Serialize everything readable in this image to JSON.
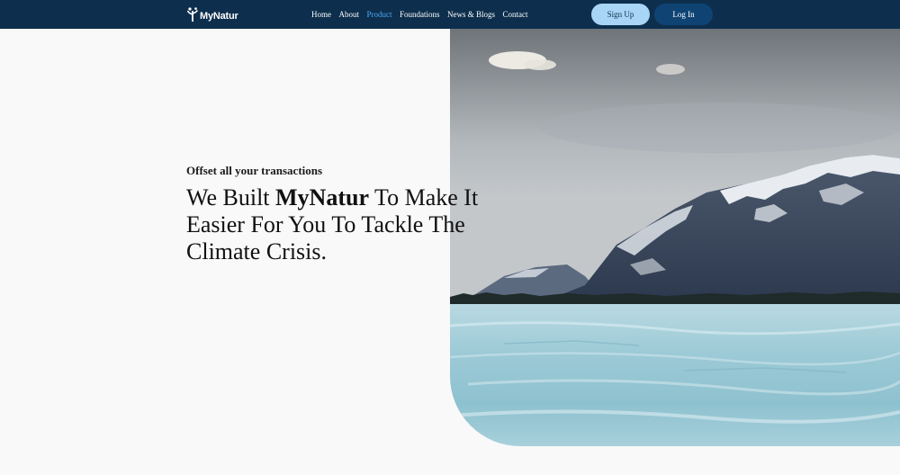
{
  "brand": {
    "name": "MyNatur"
  },
  "nav": {
    "items": [
      {
        "label": "Home",
        "active": false
      },
      {
        "label": "About",
        "active": false
      },
      {
        "label": "Product",
        "active": true
      },
      {
        "label": "Foundations",
        "active": false
      },
      {
        "label": "News & Blogs",
        "active": false
      },
      {
        "label": "Contact",
        "active": false
      }
    ],
    "signup_label": "Sign Up",
    "login_label": "Log In"
  },
  "hero": {
    "eyebrow": "Offset all your transactions",
    "heading_prefix": "We Built ",
    "heading_brand": "MyNatur",
    "heading_suffix": " To Make It Easier For You To Tackle The Climate Crisis.",
    "image_subject": "snow-capped mountains over frozen lake"
  },
  "colors": {
    "navbar_bg": "#0d2f4d",
    "nav_active": "#4aa8f5",
    "signup_bg": "#a8d5f5",
    "login_bg": "#0f4374",
    "page_bg": "#f9f9fa"
  }
}
